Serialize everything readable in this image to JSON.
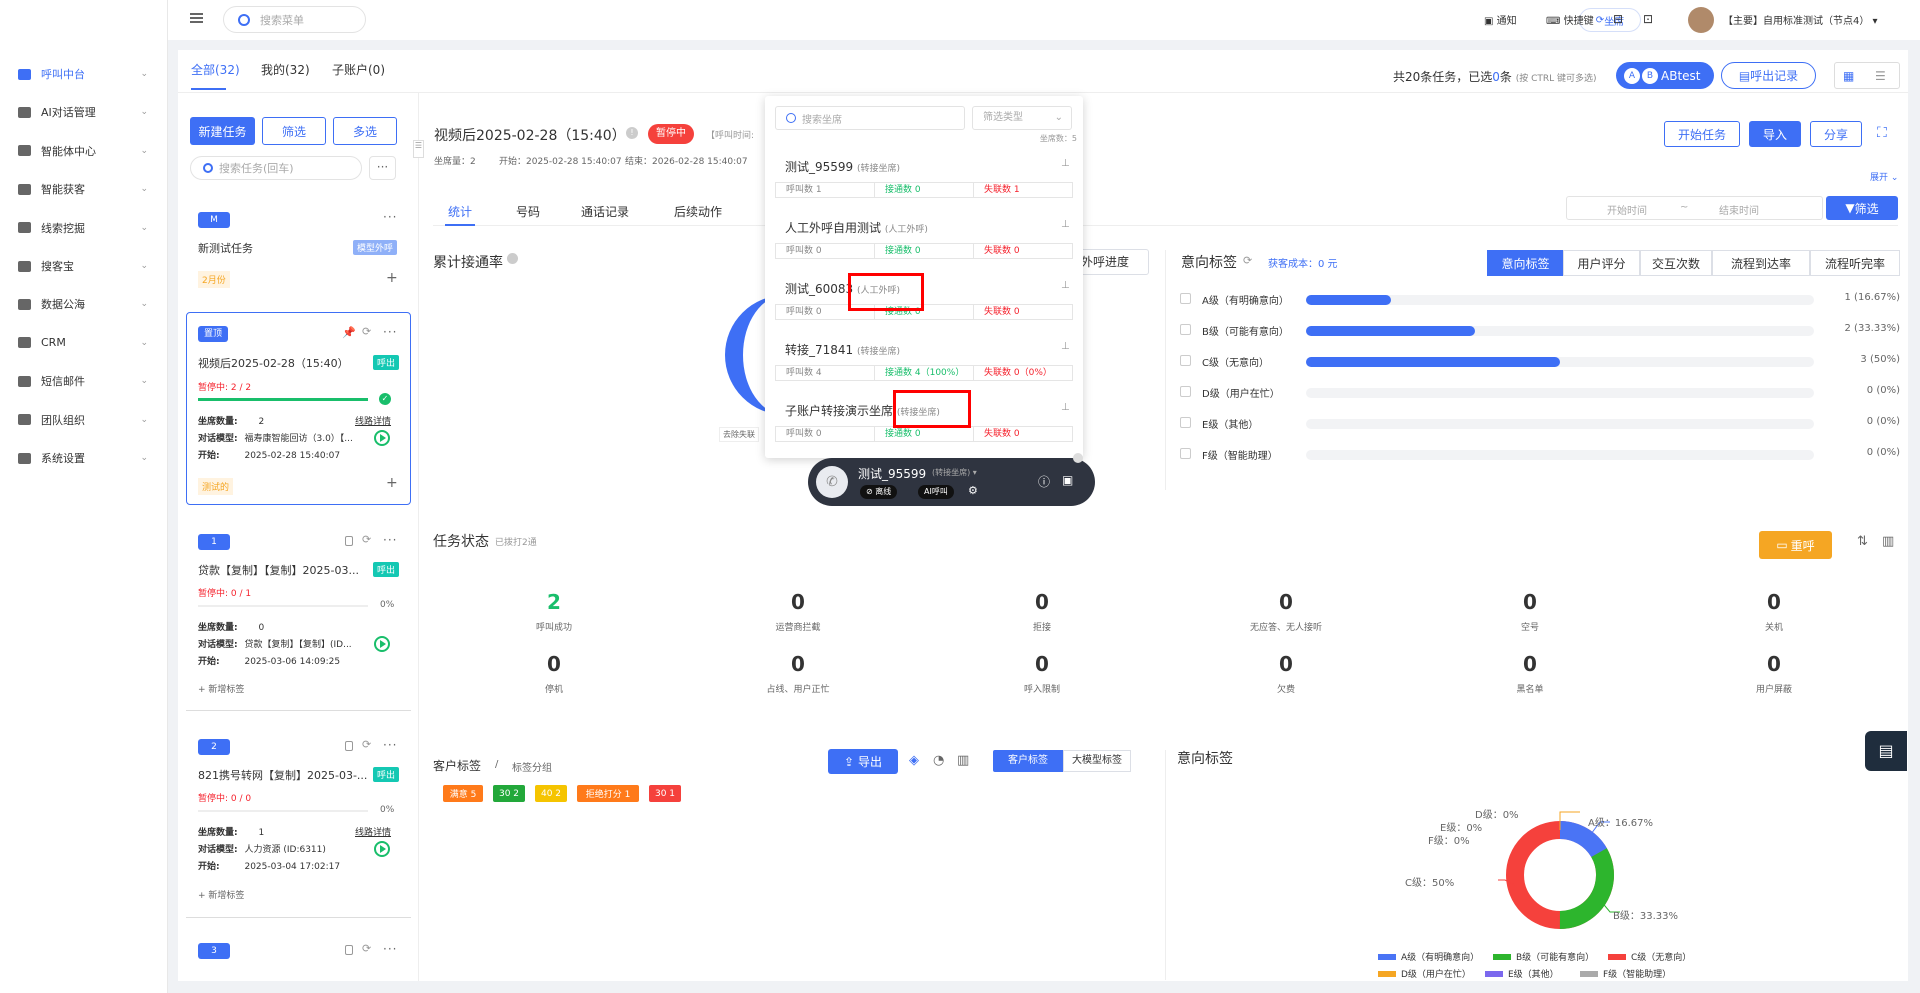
{
  "sidebar": {
    "items": [
      "呼叫中台",
      "AI对话管理",
      "智能体中心",
      "智能获客",
      "线索挖掘",
      "搜客宝",
      "数据公海",
      "CRM",
      "短信邮件",
      "团队组织",
      "系统设置"
    ]
  },
  "topbar": {
    "search_placeholder": "搜索菜单",
    "seat": "坐席",
    "notice": "通知",
    "shortcut": "快捷键",
    "user": "【主要】自用标准测试（节点4）"
  },
  "tabs": {
    "all": "全部(32)",
    "mine": "我的(32)",
    "sub": "子账户(0)"
  },
  "task_summary": {
    "pre": "共20条任务，已选",
    "count": "0",
    "post": "条",
    "hint": "(按 CTRL 键可多选)",
    "account": "ABtest",
    "outbound_record": "呼出记录"
  },
  "left": {
    "new_task": "新建任务",
    "filter": "筛选",
    "multi": "多选",
    "search_placeholder": "搜索任务(回车)"
  },
  "group1": {
    "badge": "M",
    "title": "新测试任务",
    "tag": "模型外呼",
    "month": "2月份"
  },
  "card_top": {
    "badge": "置顶",
    "title": "视频后2025-02-28（15:40）",
    "status_tag": "呼出",
    "paused": "暂停中: 2 / 2",
    "seats_label": "坐席数量:",
    "seats": "2",
    "line": "线路详情",
    "model_label": "对话模型:",
    "model": "福寿康智能回访（3.0）【...",
    "start_label": "开始:",
    "start": "2025-02-28 15:40:07",
    "footer": "测试的"
  },
  "card1": {
    "badge": "1",
    "title": "贷款【复制】【复制】2025-03...",
    "status_tag": "呼出",
    "paused": "暂停中: 0 / 1",
    "pct": "0%",
    "seats": "0",
    "model": "贷款【复制】【复制】(ID...",
    "start": "2025-03-06 14:09:25",
    "add_tag": "+ 新增标签"
  },
  "card2": {
    "badge": "2",
    "title": "821携号转网【复制】2025-03-...",
    "status_tag": "呼出",
    "paused": "暂停中: 0 / 0",
    "pct": "0%",
    "seats": "1",
    "model": "人力资源 (ID:6311)",
    "start": "2025-03-04 17:02:17",
    "add_tag": "+ 新增标签",
    "line": "线路详情"
  },
  "card3": {
    "badge": "3"
  },
  "header": {
    "title": "视频后2025-02-28（15:40）",
    "status": "暂停中",
    "call_time": "【呼叫时间:",
    "seats": "坐席量：2",
    "start": "开始：2025-02-28 15:40:07",
    "end": "结束：2026-02-28 15:40:07",
    "start_task": "开始任务",
    "import": "导入",
    "share": "分享",
    "expand": "展开"
  },
  "subtabs": [
    "统计",
    "号码",
    "通话记录",
    "后续动作"
  ],
  "time_filter": {
    "start": "开始时间",
    "sep": "~",
    "end": "结束时间",
    "filter": "筛选"
  },
  "cumulative": {
    "title": "累计接通率",
    "progress_btn": "外呼进度",
    "exclude": "去除失联"
  },
  "intent": {
    "title": "意向标签",
    "cost": "获客成本：0 元",
    "tabs": [
      "意向标签",
      "用户评分",
      "交互次数",
      "流程到达率",
      "流程听完率"
    ],
    "rows": [
      {
        "label": "A级（有明确意向）",
        "value": 0.1667,
        "pct": "1 (16.67%)"
      },
      {
        "label": "B级（可能有意向）",
        "value": 0.3333,
        "pct": "2 (33.33%)"
      },
      {
        "label": "C级（无意向）",
        "value": 0.5,
        "pct": "3 (50%)"
      },
      {
        "label": "D级（用户在忙）",
        "value": 0,
        "pct": "0 (0%)"
      },
      {
        "label": "E级（其他）",
        "value": 0,
        "pct": "0 (0%)"
      },
      {
        "label": "F级（智能助理）",
        "value": 0,
        "pct": "0 (0%)"
      }
    ]
  },
  "task_status": {
    "title": "任务状态",
    "sub": "已拨打2通",
    "recall": "重呼",
    "items": [
      {
        "n": "2",
        "l": "呼叫成功"
      },
      {
        "n": "0",
        "l": "运营商拦截"
      },
      {
        "n": "0",
        "l": "拒接"
      },
      {
        "n": "0",
        "l": "无应答、无人接听"
      },
      {
        "n": "0",
        "l": "空号"
      },
      {
        "n": "0",
        "l": "关机"
      },
      {
        "n": "0",
        "l": "停机"
      },
      {
        "n": "0",
        "l": "占线、用户正忙"
      },
      {
        "n": "0",
        "l": "呼入限制"
      },
      {
        "n": "0",
        "l": "欠费"
      },
      {
        "n": "0",
        "l": "黑名单"
      },
      {
        "n": "0",
        "l": "用户屏蔽"
      }
    ]
  },
  "customer_tags": {
    "title": "客户标签",
    "sep": "/",
    "group": "标签分组",
    "export": "导出",
    "tab1": "客户标签",
    "tab2": "大模型标签",
    "tags": [
      {
        "t": "满意 5",
        "c": "#ff7a1a"
      },
      {
        "t": "30 2",
        "c": "#22a83a"
      },
      {
        "t": "40 2",
        "c": "#f5c400"
      },
      {
        "t": "拒绝打分 1",
        "c": "#ff7a1a"
      },
      {
        "t": "30 1",
        "c": "#f5413c"
      }
    ]
  },
  "intent_pie": {
    "title": "意向标签",
    "labels": {
      "a": "A级：16.67%",
      "b": "B级：33.33%",
      "c": "C级：50%",
      "d": "D级：0%",
      "e": "E级：0%",
      "f": "F级：0%"
    },
    "legend": [
      {
        "t": "A级（有明确意向）",
        "c": "#4a74f5"
      },
      {
        "t": "B级（可能有意向）",
        "c": "#2db52d"
      },
      {
        "t": "C级（无意向）",
        "c": "#f5413c"
      },
      {
        "t": "D级（用户在忙）",
        "c": "#f5a623"
      },
      {
        "t": "E级（其他）",
        "c": "#7b68ee"
      },
      {
        "t": "F级（智能助理）",
        "c": "#aaaaaa"
      }
    ]
  },
  "dropdown": {
    "search_placeholder": "搜索坐席",
    "type_placeholder": "筛选类型",
    "count": "坐席数：5",
    "seats": [
      {
        "name": "测试_95599",
        "type": "(转接坐席)",
        "calls": "呼叫数 1",
        "conn": "接通数 0",
        "fail": "失联数 1"
      },
      {
        "name": "人工外呼自用测试",
        "type": "(人工外呼)",
        "calls": "呼叫数 0",
        "conn": "接通数 0",
        "fail": "失联数 0"
      },
      {
        "name": "测试_60083",
        "type": "(人工外呼)",
        "calls": "呼叫数 0",
        "conn": "接通数 0",
        "fail": "失联数 0"
      },
      {
        "name": "转接_71841",
        "type": "(转接坐席)",
        "calls": "呼叫数 4",
        "conn": "接通数 4（100%）",
        "fail": "失联数 0（0%）"
      },
      {
        "name": "子账户转接演示坐席",
        "type": "(转接坐席)",
        "calls": "呼叫数 0",
        "conn": "接通数 0",
        "fail": "失联数 0"
      }
    ]
  },
  "callbar": {
    "name": "测试_95599",
    "type": "(转接坐席)",
    "offline": "离线",
    "ai": "AI呼叫"
  }
}
